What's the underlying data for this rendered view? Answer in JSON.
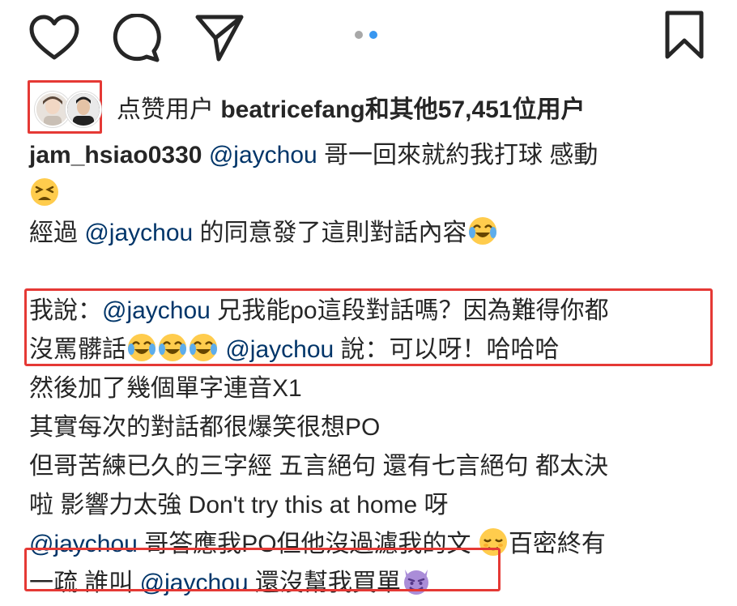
{
  "actions": {
    "like_icon": "heart-outline-icon",
    "comment_icon": "speech-bubble-icon",
    "share_icon": "paper-plane-icon",
    "save_icon": "bookmark-icon",
    "carousel_dots": 2,
    "carousel_active": 2,
    "dot_active_color": "#3897f0",
    "dot_inactive_color": "#a8a8a8"
  },
  "likes": {
    "prefix": "点赞用户 ",
    "user": "beatricefang",
    "suffix": "和其他57,451位用户"
  },
  "caption": {
    "author": "jam_hsiao0330",
    "mention": "@jaychou",
    "l1_text": " 哥一回來就約我打球 感動",
    "l3_pre": "經過 ",
    "l3_post": " 的同意發了這則對話內容",
    "l5_pre": "我說：",
    "l5_post": " 兄我能po這段對話嗎？因為難得你都",
    "l6_pre": "沒罵髒話",
    "l6_post": " 說：可以呀！哈哈哈",
    "l7": "然後加了幾個單字連音X1",
    "l8": "其實每次的對話都很爆笑很想PO",
    "l9": "但哥苦練已久的三字經 五言絕句 還有七言絕句 都太決",
    "l10": "啦 影響力太強 Don't try this at home 呀",
    "l11_post": " 哥答應我PO但他沒過濾我的文 ",
    "l11_tail": "百密終有",
    "l12_pre": "一疏 誰叫 ",
    "l12_post": " 還沒幫我買單"
  },
  "emojis": {
    "tired_face": "tired-face-emoji",
    "crying_laughing": "face-with-tears-of-joy-emoji",
    "relieved": "relieved-face-emoji",
    "smiling_devil": "smiling-face-with-horns-emoji"
  },
  "colors": {
    "text": "#262626",
    "mention": "#003569",
    "highlight": "#e53935"
  }
}
